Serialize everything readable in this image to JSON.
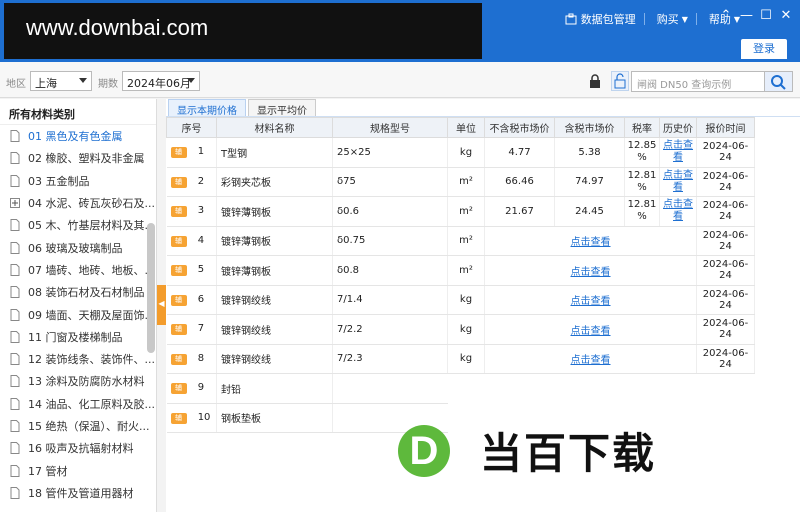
{
  "watermark": "www.downbai.com",
  "header": {
    "menu": [
      "数据包管理",
      "购买",
      "帮助"
    ],
    "login_label": "登录"
  },
  "filter": {
    "region_label": "地区",
    "region_value": "上海",
    "period_label": "期数",
    "period_value": "2024年06月",
    "search_placeholder": "闸阀 DN50 查询示例"
  },
  "sidebar": {
    "title": "所有材料类别",
    "items": [
      {
        "label": "01 黑色及有色金属",
        "active": true
      },
      {
        "label": "02 橡胶、塑料及非金属"
      },
      {
        "label": "03 五金制品"
      },
      {
        "label": "04 水泥、砖瓦灰砂石及...",
        "expandable": true
      },
      {
        "label": "05 木、竹基层材料及其..."
      },
      {
        "label": "06 玻璃及玻璃制品"
      },
      {
        "label": "07 墙砖、地砖、地板、..."
      },
      {
        "label": "08 装饰石材及石材制品"
      },
      {
        "label": "09 墙面、天棚及屋面饰..."
      },
      {
        "label": "11 门窗及楼梯制品"
      },
      {
        "label": "12 装饰线条、装饰件、..."
      },
      {
        "label": "13 涂料及防腐防水材料"
      },
      {
        "label": "14 油品、化工原料及胶..."
      },
      {
        "label": "15 绝热（保温）、耐火..."
      },
      {
        "label": "16 吸声及抗辐射材料"
      },
      {
        "label": "17 管材"
      },
      {
        "label": "18 管件及管道用器材"
      }
    ]
  },
  "tabs": [
    "显示本期价格",
    "显示平均价"
  ],
  "table": {
    "headers": [
      "序号",
      "材料名称",
      "规格型号",
      "单位",
      "不含税市场价",
      "含税市场价",
      "税率",
      "历史价",
      "报价时间"
    ],
    "badge": "辅",
    "link_text": "点击查看",
    "rows": [
      {
        "no": "1",
        "name": "T型钢",
        "spec": "25×25",
        "unit": "kg",
        "price_ex": "4.77",
        "price_in": "5.38",
        "tax": "12.85\n%",
        "date": "2024-06-24"
      },
      {
        "no": "2",
        "name": "彩钢夹芯板",
        "spec": "δ75",
        "unit": "m²",
        "price_ex": "66.46",
        "price_in": "74.97",
        "tax": "12.81\n%",
        "date": "2024-06-24"
      },
      {
        "no": "3",
        "name": "镀锌薄钢板",
        "spec": "δ0.6",
        "unit": "m²",
        "price_ex": "21.67",
        "price_in": "24.45",
        "tax": "12.81\n%",
        "date": "2024-06-24"
      },
      {
        "no": "4",
        "name": "镀锌薄钢板",
        "spec": "δ0.75",
        "unit": "m²",
        "merged": true,
        "date": "2024-06-24"
      },
      {
        "no": "5",
        "name": "镀锌薄钢板",
        "spec": "δ0.8",
        "unit": "m²",
        "merged": true,
        "date": "2024-06-24"
      },
      {
        "no": "6",
        "name": "镀锌钢绞线",
        "spec": "7/1.4",
        "unit": "kg",
        "merged": true,
        "date": "2024-06-24"
      },
      {
        "no": "7",
        "name": "镀锌钢绞线",
        "spec": "7/2.2",
        "unit": "kg",
        "merged": true,
        "date": "2024-06-24"
      },
      {
        "no": "8",
        "name": "镀锌钢绞线",
        "spec": "7/2.3",
        "unit": "kg",
        "merged": true,
        "date": "2024-06-24"
      },
      {
        "no": "9",
        "name": "封铅",
        "partial": true
      },
      {
        "no": "10",
        "name": "钢板垫板",
        "partial": true
      }
    ]
  },
  "brand": {
    "mark": "D",
    "text": "当百下载"
  },
  "colors": {
    "accent": "#1e6fd1",
    "badge": "#f6a333",
    "brand_green": "#5eb93c"
  }
}
